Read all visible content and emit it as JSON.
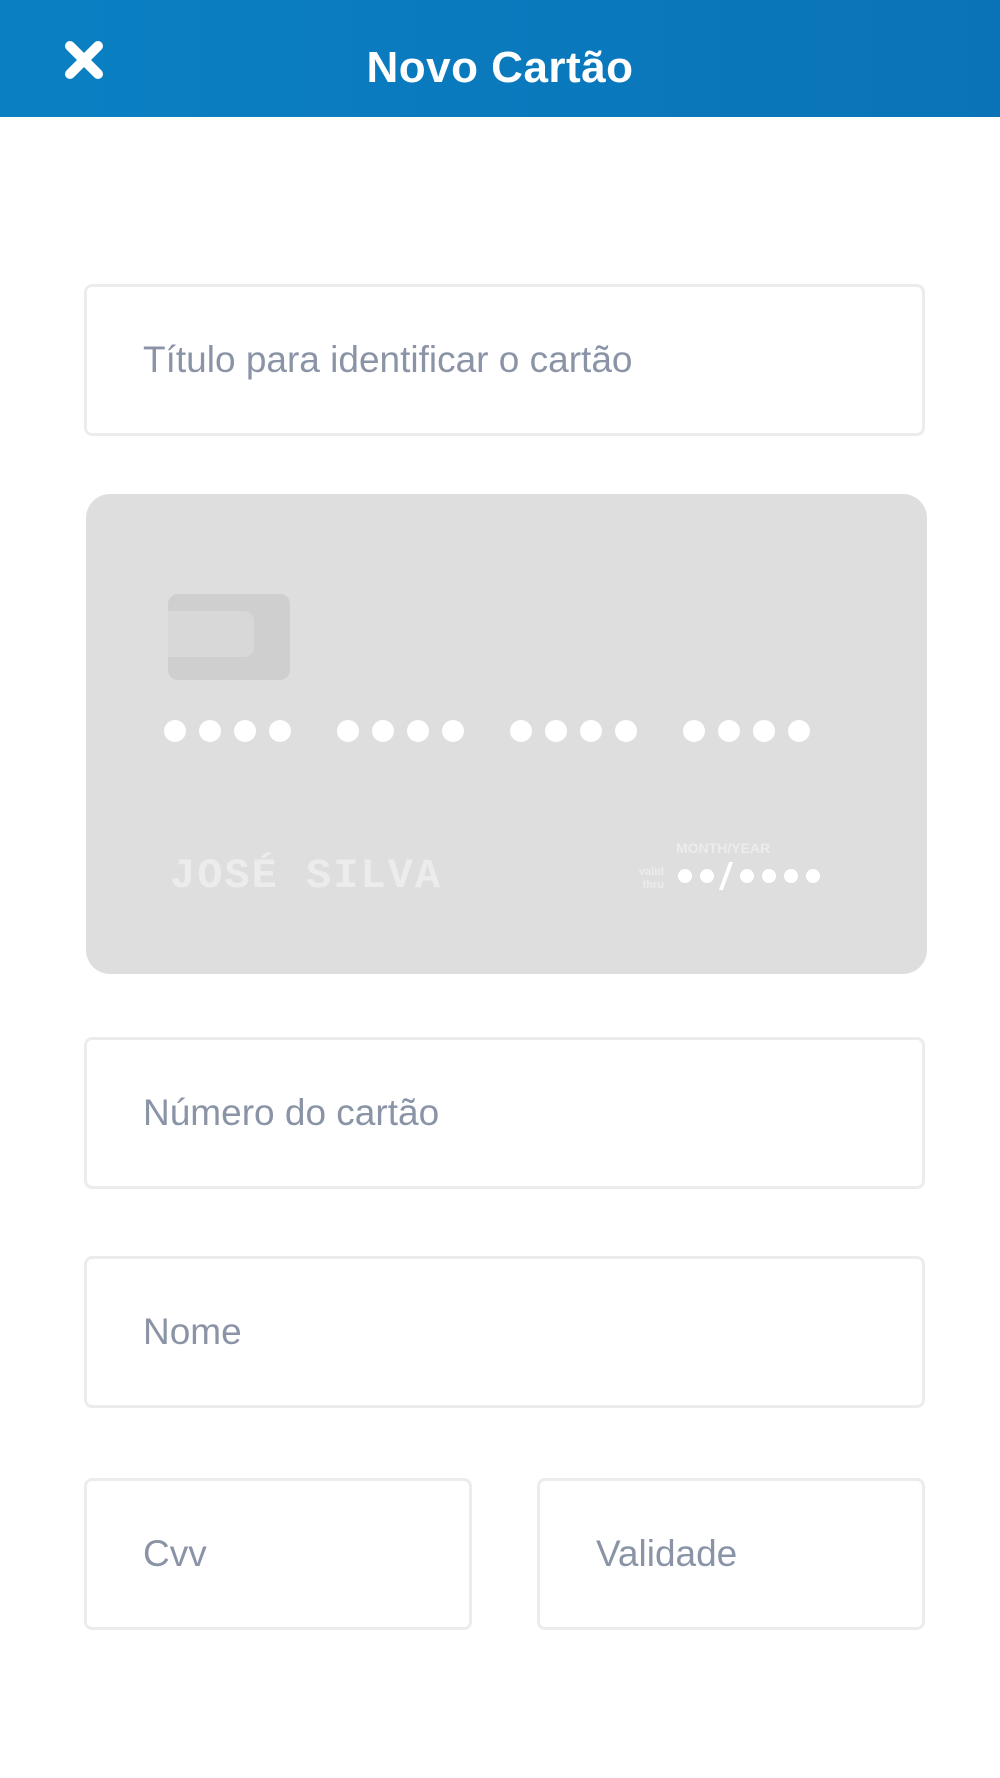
{
  "header": {
    "title": "Novo Cartão",
    "close_icon": "close-icon",
    "background": "#0a7cc0"
  },
  "form": {
    "title_placeholder": "Título para identificar o cartão",
    "number_placeholder": "Número do cartão",
    "name_placeholder": "Nome",
    "cvv_placeholder": "Cvv",
    "validity_placeholder": "Validade"
  },
  "card_preview": {
    "holder_name": "JOSÉ SILVA",
    "valid_thru_label": "valid thru",
    "month_year_label": "MONTH/YEAR",
    "background": "#dedede"
  }
}
